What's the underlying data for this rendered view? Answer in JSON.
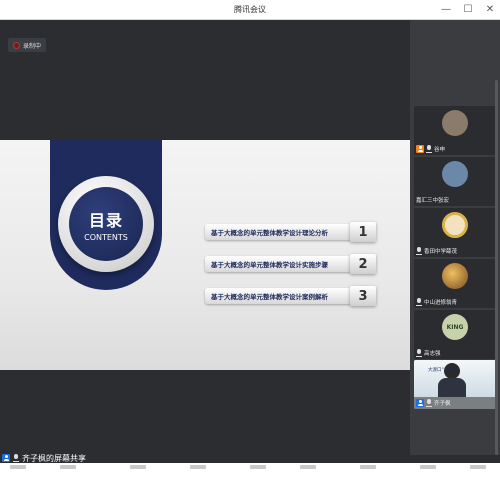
{
  "window": {
    "title": "腾讯会议",
    "minimize_glyph": "—",
    "maximize_glyph": "☐",
    "close_glyph": "✕"
  },
  "recording": {
    "label": "录制中",
    "icon": "record-icon"
  },
  "slide": {
    "heading": "目录",
    "subheading": "CONTENTS",
    "items": [
      {
        "label": "基于大概念的单元整体教学设计理论分析",
        "number": "1"
      },
      {
        "label": "基于大概念的单元整体教学设计实施步骤",
        "number": "2"
      },
      {
        "label": "基于大概念的单元整体教学设计案例解析",
        "number": "3"
      }
    ]
  },
  "participants": [
    {
      "name": "谷申",
      "badge": "host-icon",
      "avatar_color": "#8a7b6a"
    },
    {
      "name": "嘉汇三中张宏",
      "badge": "",
      "avatar_color": "#6c88a8"
    },
    {
      "name": "香田中学薛茂",
      "badge": "",
      "avatar_color": "#d8b24a"
    },
    {
      "name": "中山进修翁青",
      "badge": "",
      "avatar_color": "#9a6a3a"
    },
    {
      "name": "高志强",
      "badge": "",
      "avatar_color": "#b7c49a",
      "avatar_text": "KING"
    },
    {
      "name": "齐子枫",
      "badge": "user-icon",
      "avatar_color": "#e8eef2",
      "video_caption": "大渡口“十四五”"
    }
  ],
  "share_status": {
    "label": "齐子枫的屏幕共享"
  }
}
